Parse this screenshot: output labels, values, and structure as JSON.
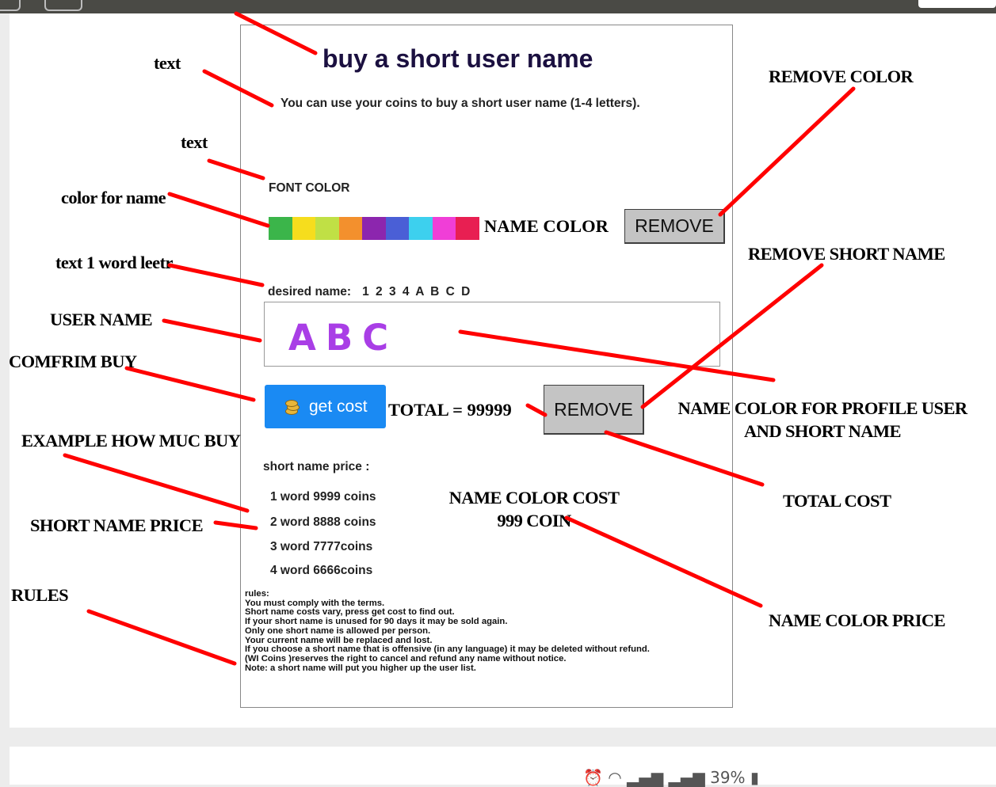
{
  "form": {
    "title": "buy a short user name",
    "subtitle": "You can use your coins  to buy a short user name (1-4 letters).",
    "font_color_label": "FONT COLOR",
    "swatch_colors": [
      "#3bb54a",
      "#f6dd1d",
      "#c0e045",
      "#f3902d",
      "#8c26ae",
      "#4a5fd6",
      "#3dd0ee",
      "#f03ed7",
      "#e81f52"
    ],
    "name_color_label": "NAME COLOR",
    "remove_color_label": "REMOVE",
    "desired_label": "desired name:",
    "desired_example": "1 2 3 4  A B C D",
    "name_display": "ABC",
    "name_display_color": "#a93ee6",
    "get_cost_label": "get cost",
    "total_label": "TOTAL = 99999",
    "remove_short_label": "REMOVE",
    "price_title": "short name price :",
    "prices": [
      "1 word  9999 coins",
      "2 word  8888 coins",
      "3 word  7777coins",
      "4 word  6666coins"
    ],
    "rules": [
      "rules:",
      "You must comply with the terms.",
      "Short name costs vary, press get cost to find out.",
      "If your short name is unused for 90 days it may be sold again.",
      "Only one short name is allowed per person.",
      "Your current name will be replaced and lost.",
      "If you choose a short name that is offensive (in any language) it may be deleted without refund.",
      "(WI Coins )reserves the right to cancel and refund any name without notice.",
      "Note: a short name will put you higher up the user list."
    ]
  },
  "annotations": {
    "text1": "text",
    "text2": "text",
    "color_for_name": "color for name",
    "text_1_word": "text 1 word leetr",
    "user_name": "USER NAME",
    "confirm_buy": "COMFRIM BUY",
    "example_buy": "EXAMPLE HOW MUC BUY",
    "short_name_price": "SHORT NAME PRICE",
    "rules": "RULES",
    "remove_color": "REMOVE COLOR",
    "remove_short_name": "REMOVE SHORT NAME",
    "profile_color_line1": "NAME COLOR FOR PROFILE USER",
    "profile_color_line2": "AND SHORT NAME",
    "total_cost": "TOTAL COST",
    "name_color_cost_line1": "NAME COLOR COST",
    "name_color_cost_line2": "999 COIN",
    "name_color_price": "NAME COLOR PRICE"
  },
  "status_bar": {
    "battery": "39%"
  }
}
